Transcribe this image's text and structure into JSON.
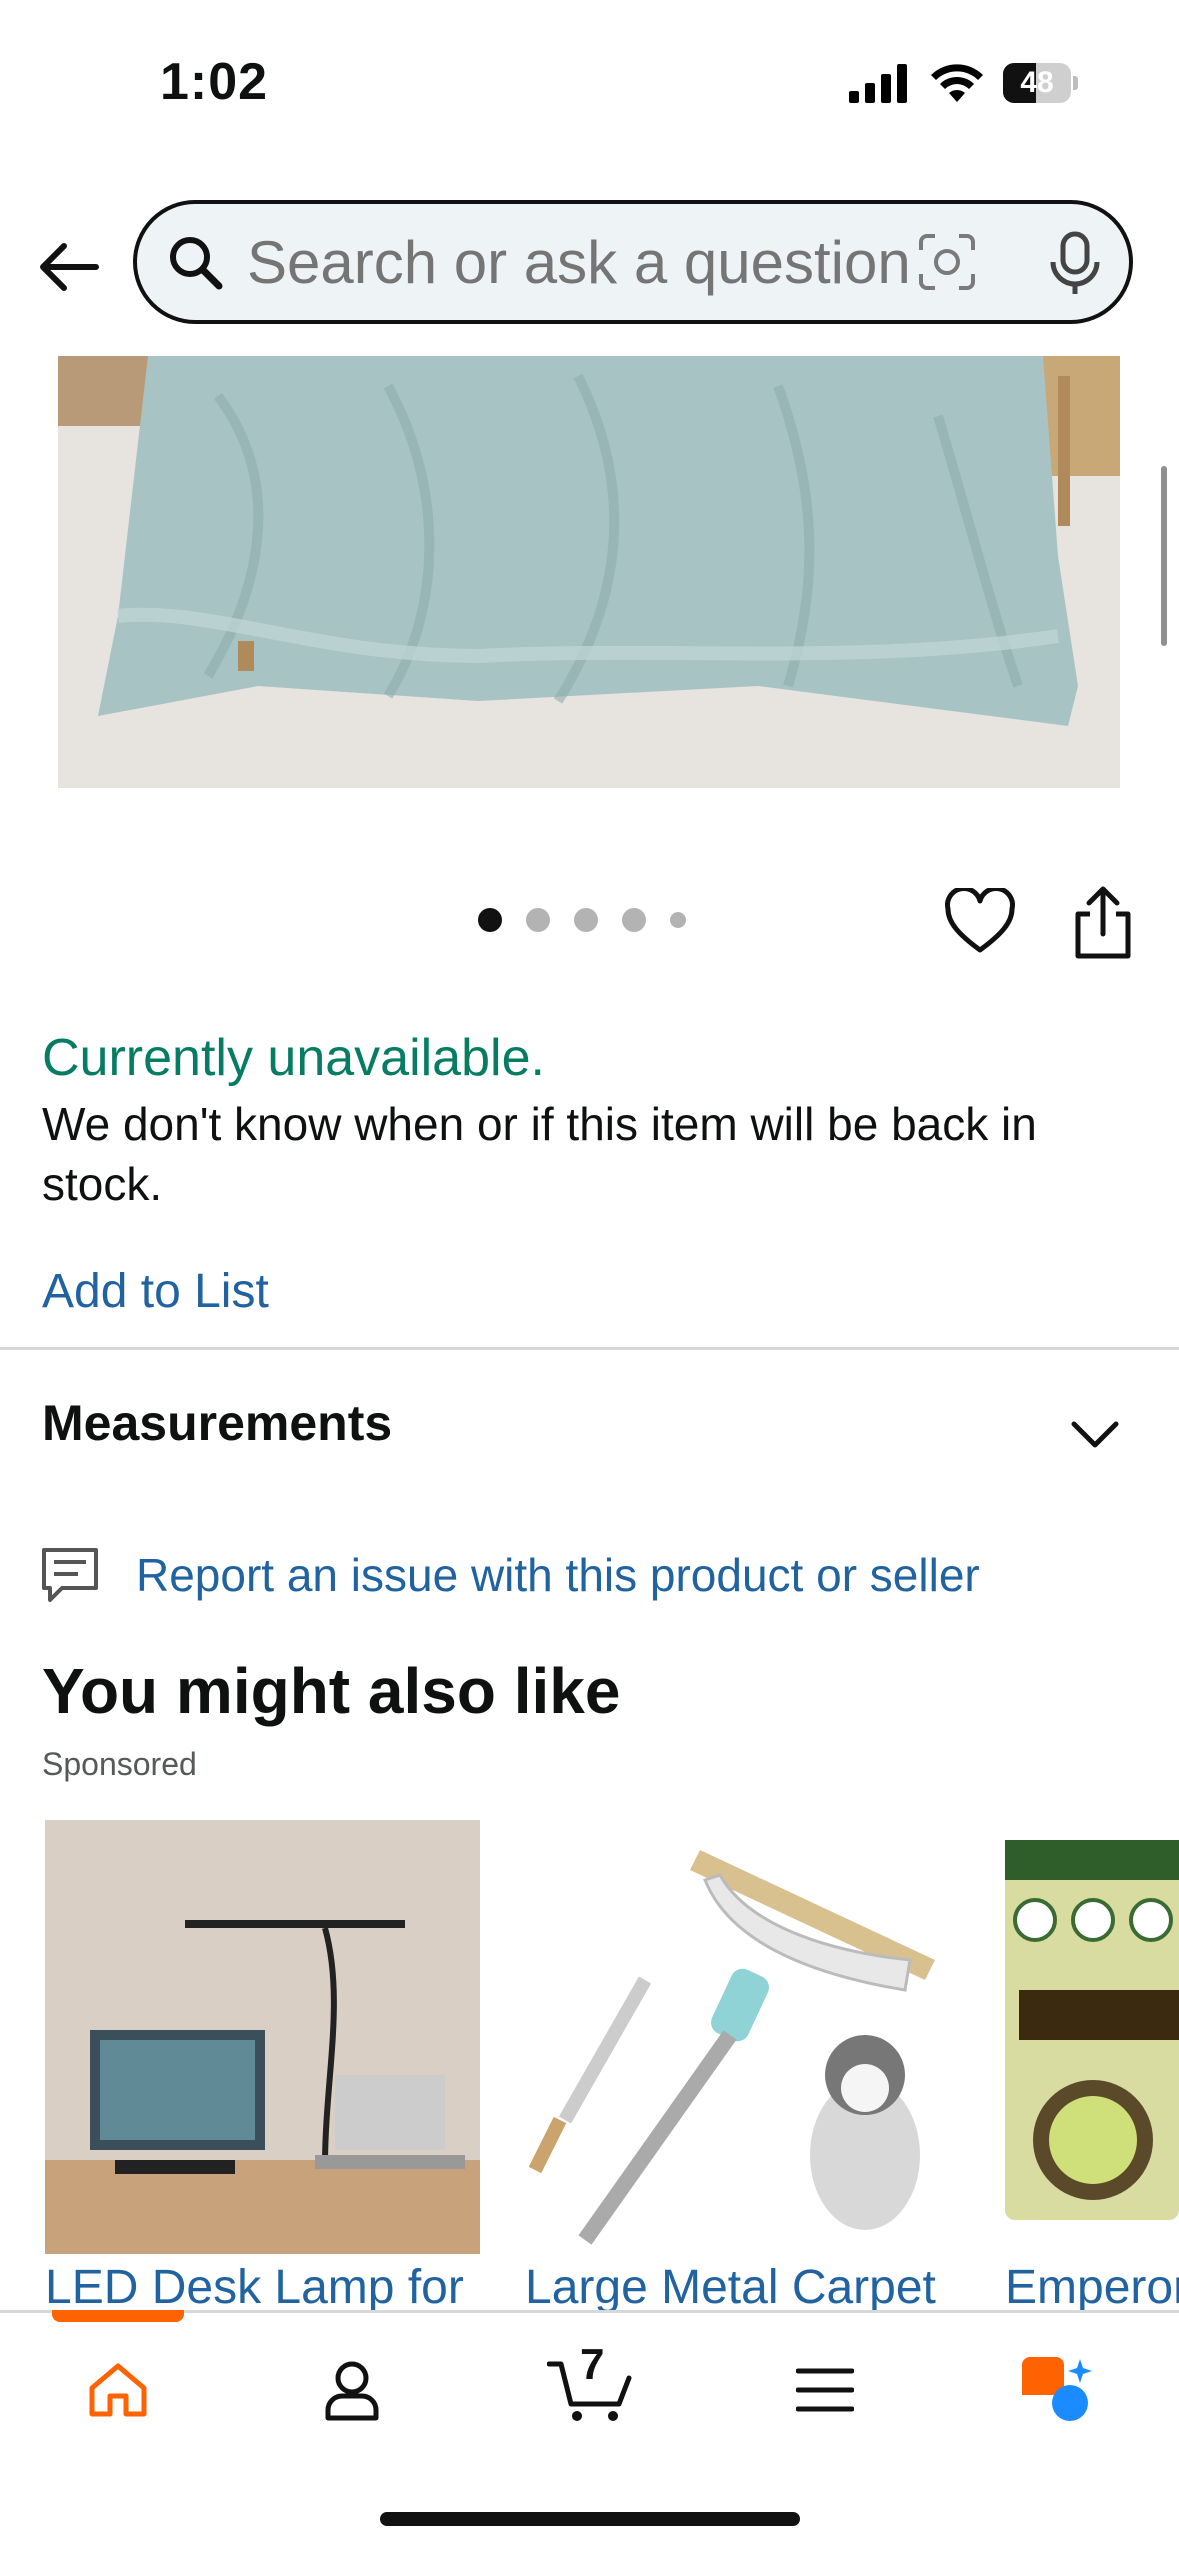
{
  "status_bar": {
    "time": "1:02",
    "battery_level": "48"
  },
  "header": {
    "search_placeholder": "Search or ask a question"
  },
  "carousel": {
    "total_images": 5,
    "active_index": 0
  },
  "availability": {
    "status": "Currently unavailable.",
    "message": "We don't know when or if this item will be back in stock.",
    "add_to_list": "Add to List"
  },
  "measurements": {
    "title": "Measurements"
  },
  "report": {
    "label": "Report an issue with this product or seller"
  },
  "recommendations": {
    "title": "You might also like",
    "sponsored_label": "Sponsored",
    "items": [
      {
        "title": "LED Desk Lamp for"
      },
      {
        "title": "Large Metal Carpet"
      },
      {
        "title": "Emperor"
      }
    ]
  },
  "bottom_nav": {
    "items": [
      "home-icon",
      "account-icon",
      "cart-icon",
      "menu-icon",
      "rufus-icon"
    ],
    "cart_count": "7",
    "active": "home"
  },
  "colors": {
    "link": "#2162a1",
    "available_status": "#067d62",
    "accent": "#ff6200"
  }
}
